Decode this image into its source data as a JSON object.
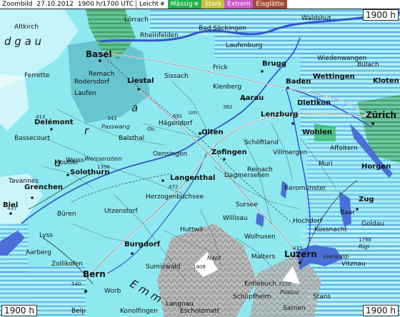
{
  "header": {
    "title": "Zoombild",
    "date": "27.10.2012",
    "time": "1900 h/1700 UTC"
  },
  "legend": [
    {
      "label": "Leicht",
      "symbol": "❄",
      "color": "#ffffff"
    },
    {
      "label": "Mässig",
      "symbol": "❄",
      "color": "#22b14c"
    },
    {
      "label": "Stark",
      "symbol": "",
      "color": "#c6c23b"
    },
    {
      "label": "Extrem",
      "symbol": "",
      "color": "#cb57c8"
    },
    {
      "label": "Eisglätte",
      "symbol": "",
      "color": "#a04b36"
    }
  ],
  "corner_labels": {
    "top_right": "1900 h",
    "bottom_left": "1900 h",
    "bottom_right": "1900 h"
  },
  "map": {
    "places": [
      {
        "name": "Basel",
        "kind": "big"
      },
      {
        "name": "Lörrach",
        "kind": "place"
      },
      {
        "name": "Rheinfelden",
        "kind": "place"
      },
      {
        "name": "Bad Säckingen",
        "kind": "place"
      },
      {
        "name": "Waldshut",
        "kind": "place"
      },
      {
        "name": "Liestal",
        "kind": "city"
      },
      {
        "name": "Laufen",
        "kind": "place"
      },
      {
        "name": "Delémont",
        "kind": "city"
      },
      {
        "name": "Olten",
        "kind": "city"
      },
      {
        "name": "Aarau",
        "kind": "city"
      },
      {
        "name": "Brugg",
        "kind": "city"
      },
      {
        "name": "Baden",
        "kind": "city"
      },
      {
        "name": "Wettingen",
        "kind": "city"
      },
      {
        "name": "Bülach",
        "kind": "place"
      },
      {
        "name": "Kloten",
        "kind": "city"
      },
      {
        "name": "Zürich",
        "kind": "big"
      },
      {
        "name": "Dietikon",
        "kind": "city"
      },
      {
        "name": "Lenzburg",
        "kind": "city"
      },
      {
        "name": "Wohlen",
        "kind": "city"
      },
      {
        "name": "Zofingen",
        "kind": "city"
      },
      {
        "name": "Langenthal",
        "kind": "city"
      },
      {
        "name": "Solothurn",
        "kind": "city"
      },
      {
        "name": "Grenchen",
        "kind": "city"
      },
      {
        "name": "Biel",
        "kind": "city"
      },
      {
        "name": "Burgdorf",
        "kind": "city"
      },
      {
        "name": "Bern",
        "kind": "big"
      },
      {
        "name": "Luzern",
        "kind": "big"
      },
      {
        "name": "Zug",
        "kind": "city"
      },
      {
        "name": "Horgen",
        "kind": "city"
      },
      {
        "name": "Sursee",
        "kind": "place"
      },
      {
        "name": "Willisau",
        "kind": "place"
      },
      {
        "name": "Beromünster",
        "kind": "place"
      },
      {
        "name": "Langnau",
        "kind": "place"
      },
      {
        "name": "Entlebuch",
        "kind": "place"
      },
      {
        "name": "Huttwil",
        "kind": "place"
      },
      {
        "name": "Sumiswald",
        "kind": "place"
      },
      {
        "name": "Napf",
        "kind": "place"
      },
      {
        "name": "Pilatus",
        "kind": "place"
      },
      {
        "name": "Rigi",
        "kind": "place"
      },
      {
        "name": "Vierwald-",
        "kind": "place"
      },
      {
        "name": "Sarnen",
        "kind": "place"
      },
      {
        "name": "Stans",
        "kind": "place"
      },
      {
        "name": "Schüpfheim",
        "kind": "place"
      },
      {
        "name": "Hochdorf",
        "kind": "place"
      },
      {
        "name": "Reinach",
        "kind": "place"
      },
      {
        "name": "Muri",
        "kind": "place"
      },
      {
        "name": "Küssnacht",
        "kind": "place"
      },
      {
        "name": "Weiss",
        "kind": "place"
      },
      {
        "name": "Balsthal",
        "kind": "place"
      },
      {
        "name": "Oensingen",
        "kind": "place"
      },
      {
        "name": "Hägendorf",
        "kind": "place"
      },
      {
        "name": "Sissach",
        "kind": "place"
      },
      {
        "name": "Frick",
        "kind": "place"
      },
      {
        "name": "Kienberg",
        "kind": "place"
      },
      {
        "name": "Remach",
        "kind": "place"
      },
      {
        "name": "Rodersdorf",
        "kind": "place"
      },
      {
        "name": "Breitenbach",
        "kind": "place"
      },
      {
        "name": "Passwang",
        "kind": "place"
      },
      {
        "name": "Weissenstein",
        "kind": "place"
      },
      {
        "name": "Moutier",
        "kind": "place"
      },
      {
        "name": "Bassecourt",
        "kind": "place"
      },
      {
        "name": "Tavannes",
        "kind": "place"
      },
      {
        "name": "Herzogenbuchsee",
        "kind": "place"
      },
      {
        "name": "Utzenstorf",
        "kind": "place"
      },
      {
        "name": "Büren",
        "kind": "place"
      },
      {
        "name": "Lyss",
        "kind": "place"
      },
      {
        "name": "Aarberg",
        "kind": "place"
      },
      {
        "name": "Zollikofen",
        "kind": "place"
      },
      {
        "name": "Worb",
        "kind": "place"
      },
      {
        "name": "Konolfingen",
        "kind": "place"
      },
      {
        "name": "Belp",
        "kind": "place"
      },
      {
        "name": "Escholzmatt",
        "kind": "place"
      },
      {
        "name": "Wolhusen",
        "kind": "place"
      },
      {
        "name": "Malters",
        "kind": "place"
      },
      {
        "name": "Schöftland",
        "kind": "place"
      },
      {
        "name": "Dagmersellen",
        "kind": "place"
      },
      {
        "name": "Villmergen",
        "kind": "place"
      },
      {
        "name": "Waldenburg",
        "kind": "place"
      },
      {
        "name": "Laufenburg",
        "kind": "place"
      },
      {
        "name": "Wiedenwangen",
        "kind": "place"
      },
      {
        "name": "Ferrette",
        "kind": "place"
      },
      {
        "name": "Altkirch",
        "kind": "place"
      },
      {
        "name": "Pierre",
        "kind": "place"
      },
      {
        "name": "Suns",
        "kind": "place"
      },
      {
        "name": "Giswil",
        "kind": "place"
      },
      {
        "name": "Baar",
        "kind": "place"
      },
      {
        "name": "Vitznau",
        "kind": "place"
      },
      {
        "name": "Goldau",
        "kind": "place"
      },
      {
        "name": "Affoltern",
        "kind": "place"
      },
      {
        "name": "Gravanggen",
        "kind": "place"
      },
      {
        "name": "Nordhel",
        "kind": "place"
      },
      {
        "name": "Lier",
        "kind": "place"
      },
      {
        "name": "Sundgau",
        "kind": "region"
      },
      {
        "name": "Jura",
        "kind": "region"
      },
      {
        "name": "Emme",
        "kind": "region"
      }
    ],
    "label_short": {
      "sundgau_1": "d g a u",
      "jura_r": "r",
      "jura_a": "a",
      "jura_u": "u",
      "emme_e": "E m m"
    },
    "elevations": [
      "413",
      "437",
      "483",
      "343",
      "382",
      "472",
      "1396",
      "1408",
      "1798",
      "2120",
      "540",
      "691",
      "433"
    ],
    "road_numbers": [
      "Um.",
      "Ob."
    ],
    "colors": {
      "base_map": "#8ee8f0",
      "light_snow": "#ffffff",
      "moderate_snow": "#22b14c",
      "heavy_snow": "#c6c23b",
      "extreme": "#cb57c8",
      "ice": "#a04b36",
      "water": "#4a6fd8",
      "relief": "#9a9a9a"
    }
  }
}
